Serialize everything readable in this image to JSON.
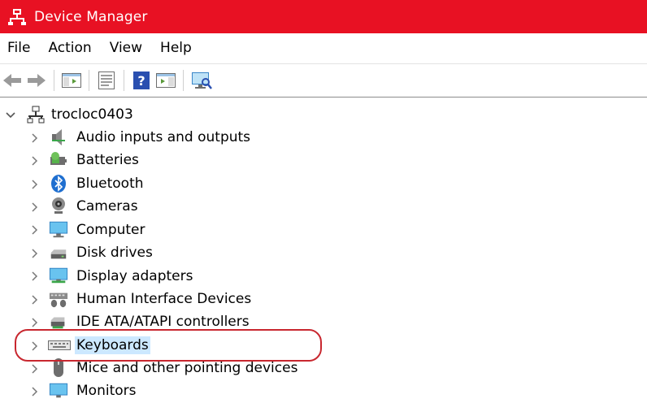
{
  "window": {
    "title": "Device Manager",
    "accent": "#e81123"
  },
  "menu": [
    "File",
    "Action",
    "View",
    "Help"
  ],
  "toolbar": {
    "buttons": [
      "back-icon",
      "forward-icon",
      "show-hide-console-tree-icon",
      "properties-icon",
      "help-icon",
      "action-pane-icon",
      "scan-hardware-icon"
    ]
  },
  "tree": {
    "root": "trocloc0403",
    "items": [
      {
        "label": "Audio inputs and outputs",
        "icon": "speaker-icon"
      },
      {
        "label": "Batteries",
        "icon": "battery-icon"
      },
      {
        "label": "Bluetooth",
        "icon": "bluetooth-icon"
      },
      {
        "label": "Cameras",
        "icon": "camera-icon"
      },
      {
        "label": "Computer",
        "icon": "computer-icon"
      },
      {
        "label": "Disk drives",
        "icon": "disk-drive-icon"
      },
      {
        "label": "Display adapters",
        "icon": "display-adapter-icon"
      },
      {
        "label": "Human Interface Devices",
        "icon": "hid-icon"
      },
      {
        "label": "IDE ATA/ATAPI controllers",
        "icon": "ide-controller-icon"
      },
      {
        "label": "Keyboards",
        "icon": "keyboard-icon"
      },
      {
        "label": "Mice and other pointing devices",
        "icon": "mouse-icon"
      },
      {
        "label": "Monitors",
        "icon": "monitor-icon"
      }
    ]
  }
}
